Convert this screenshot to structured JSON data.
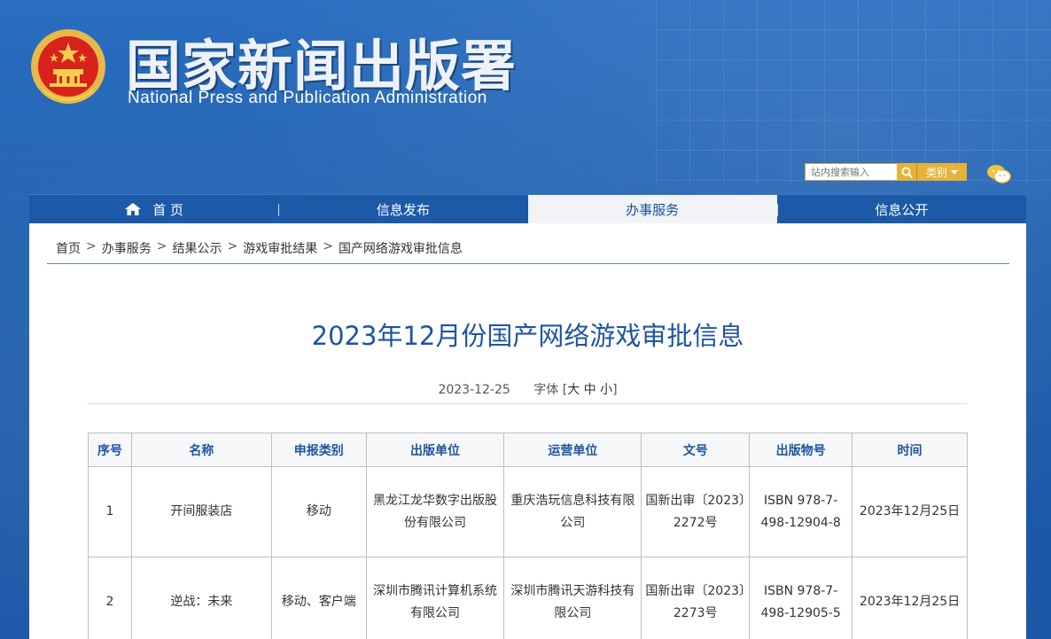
{
  "header": {
    "title_cn": "国家新闻出版署",
    "title_en": "National Press and Publication Administration",
    "search_placeholder": "站内搜索输入",
    "category_label": "类别"
  },
  "nav": [
    {
      "label": "首 页",
      "icon": "home-icon"
    },
    {
      "label": "信息发布"
    },
    {
      "label": "办事服务",
      "active": true
    },
    {
      "label": "信息公开"
    }
  ],
  "breadcrumb": [
    "首页",
    "办事服务",
    "结果公示",
    "游戏审批结果",
    "国产网络游戏审批信息"
  ],
  "article": {
    "title": "2023年12月份国产网络游戏审批信息",
    "date": "2023-12-25",
    "font_label": "字体 [",
    "font_large": "大",
    "font_medium": "中",
    "font_small": "小",
    "font_close": "]"
  },
  "table": {
    "headers": [
      "序号",
      "名称",
      "申报类别",
      "出版单位",
      "运营单位",
      "文号",
      "出版物号",
      "时间"
    ],
    "rows": [
      [
        "1",
        "开间服装店",
        "移动",
        "黑龙江龙华数字出版股份有限公司",
        "重庆浩玩信息科技有限公司",
        "国新出审〔2023〕2272号",
        "ISBN 978-7-498-12904-8",
        "2023年12月25日"
      ],
      [
        "2",
        "逆战：未来",
        "移动、客户端",
        "深圳市腾讯计算机系统有限公司",
        "深圳市腾讯天游科技有限公司",
        "国新出审〔2023〕2273号",
        "ISBN 978-7-498-12905-5",
        "2023年12月25日"
      ]
    ]
  },
  "colors": {
    "brand_blue": "#1c5aa8",
    "title_blue": "#1f55a0",
    "accent_gold": "#e6b23a",
    "emblem_red": "#d8231c"
  }
}
